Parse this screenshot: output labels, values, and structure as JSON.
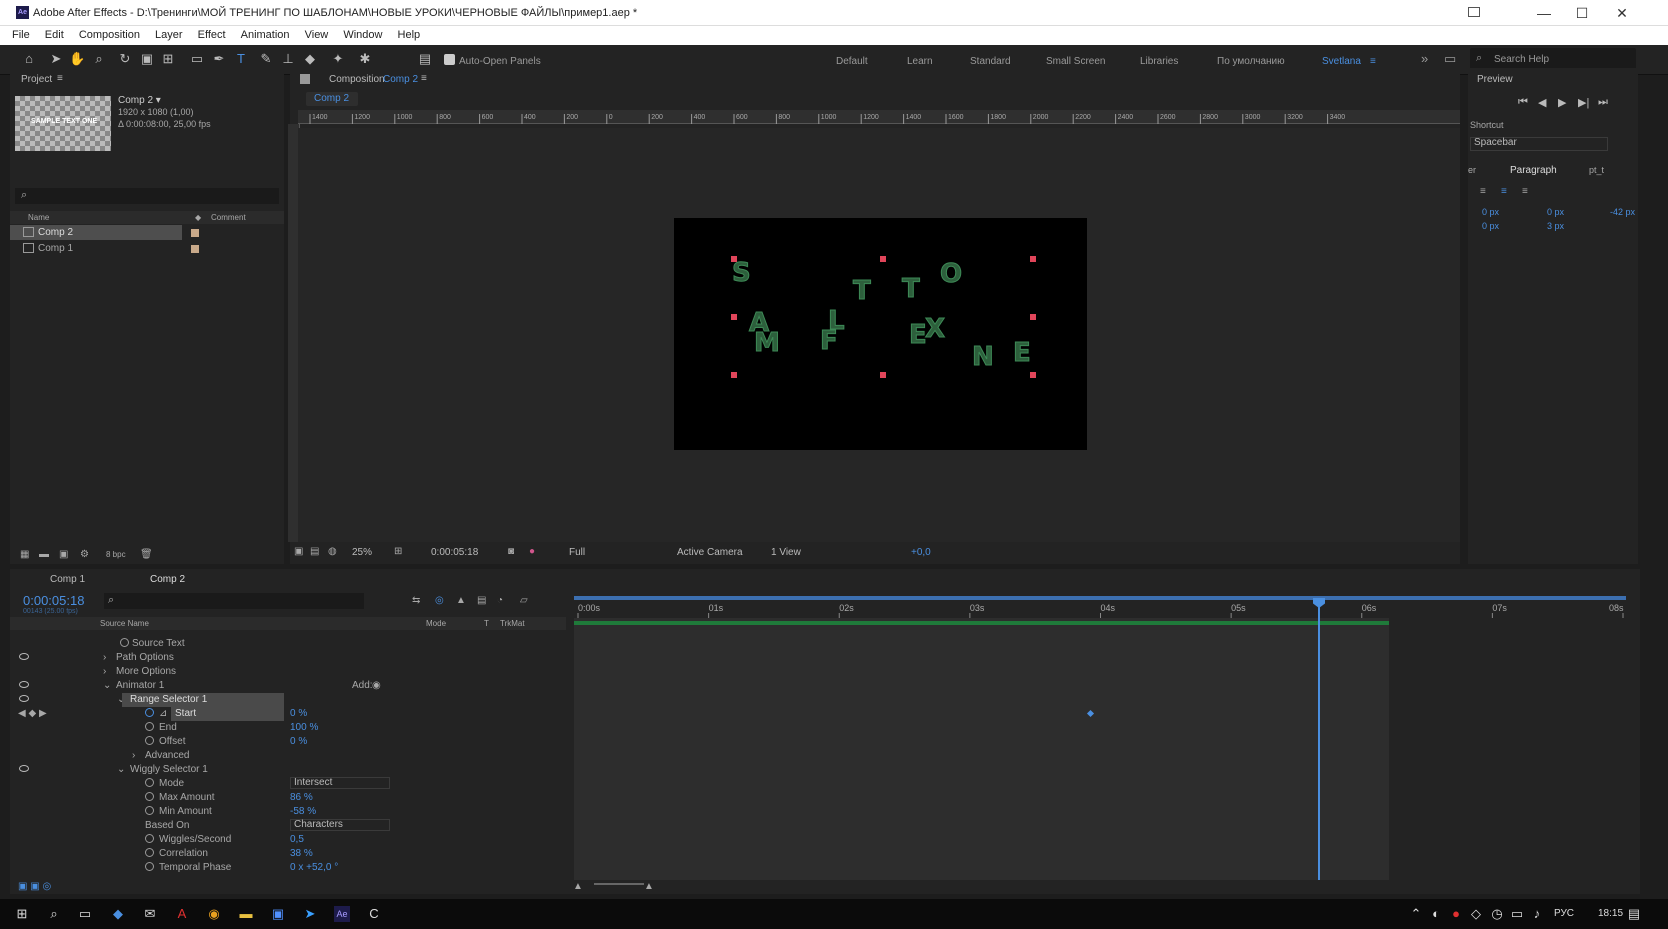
{
  "window": {
    "title": "Adobe After Effects - D:\\Тренинги\\МОЙ ТРЕНИНГ ПО ШАБЛОНАМ\\НОВЫЕ УРОКИ\\ЧЕРНОВЫЕ ФАЙЛЫ\\пример1.aep *",
    "logo": "Ae",
    "minimize": "—",
    "maximize": "☐",
    "close": "✕"
  },
  "menu": [
    "File",
    "Edit",
    "Composition",
    "Layer",
    "Effect",
    "Animation",
    "View",
    "Window",
    "Help"
  ],
  "toolbar": {
    "auto_open": "Auto-Open Panels",
    "workspaces": [
      "Default",
      "Learn",
      "Standard",
      "Small Screen",
      "Libraries",
      "По умолчанию",
      "Svetlana"
    ],
    "search_placeholder": "Search Help"
  },
  "project": {
    "title": "Project",
    "comp_name": "Comp 2 ▾",
    "comp_res": "1920 x 1080 (1,00)",
    "comp_dur": "Δ 0:00:08:00, 25,00 fps",
    "thumb_text": "SAMPLE TEXT ONE",
    "col_name": "Name",
    "col_comment": "Comment",
    "items": [
      "Comp 2",
      "Comp 1"
    ],
    "bpc": "8 bpc"
  },
  "viewer": {
    "title": "Composition",
    "comp": "Comp 2",
    "tab": "Comp 2",
    "zoom": "25%",
    "time": "0:00:05:18",
    "quality": "Full",
    "camera": "Active Camera",
    "views": "1 View",
    "exposure": "+0,0",
    "ruler": [
      "1400",
      "1200",
      "1000",
      "800",
      "600",
      "400",
      "200",
      "0",
      "200",
      "400",
      "600",
      "800",
      "1000",
      "1200",
      "1400",
      "1600",
      "1800",
      "2000",
      "2200",
      "2400",
      "2600",
      "2800",
      "3000",
      "3200",
      "3400"
    ],
    "letters": [
      "S",
      "T",
      "T",
      "O",
      "A",
      "M",
      "L",
      "F",
      "E",
      "X",
      "N",
      "E"
    ]
  },
  "preview": {
    "title": "Preview",
    "shortcut_label": "Shortcut",
    "shortcut": "Spacebar"
  },
  "paragraph": {
    "title": "Paragraph",
    "tab_left": "er",
    "tab_right": "pt_t",
    "v1": "0 px",
    "v2": "0 px",
    "v3": "-42 px",
    "v4": "0 px",
    "v5": "3 px"
  },
  "timeline": {
    "tabs": [
      "Comp 1",
      "Comp 2"
    ],
    "current_time": "0:00:05:18",
    "sub_time": "00143 (25.00 fps)",
    "col_source": "Source Name",
    "col_mode": "Mode",
    "col_t": "T",
    "col_trkmat": "TrkMat",
    "time_labels": [
      "0:00s",
      "01s",
      "02s",
      "03s",
      "04s",
      "05s",
      "06s",
      "07s",
      "08s"
    ],
    "rows": [
      {
        "label": "Source Text"
      },
      {
        "label": "Path Options"
      },
      {
        "label": "More Options"
      },
      {
        "label": "Animator 1",
        "add": "Add:"
      },
      {
        "label": "Range Selector 1"
      },
      {
        "label": "Start",
        "value": "0 %"
      },
      {
        "label": "End",
        "value": "100 %"
      },
      {
        "label": "Offset",
        "value": "0 %"
      },
      {
        "label": "Advanced"
      },
      {
        "label": "Wiggly Selector 1"
      },
      {
        "label": "Mode",
        "value": "Intersect"
      },
      {
        "label": "Max Amount",
        "value": "86 %"
      },
      {
        "label": "Min Amount",
        "value": "-58 %"
      },
      {
        "label": "Based On",
        "value": "Characters"
      },
      {
        "label": "Wiggles/Second",
        "value": "0,5"
      },
      {
        "label": "Correlation",
        "value": "38 %"
      },
      {
        "label": "Temporal Phase",
        "value": "0 x +52,0 °"
      }
    ]
  },
  "taskbar": {
    "lang": "РУС",
    "clock": "18:15"
  },
  "colors": {
    "accent": "#4a8fe0",
    "green_bar": "#1f7a3a",
    "letter": "#3d8a56",
    "handle": "#e0455a",
    "playhead": "#4a8fe0"
  }
}
